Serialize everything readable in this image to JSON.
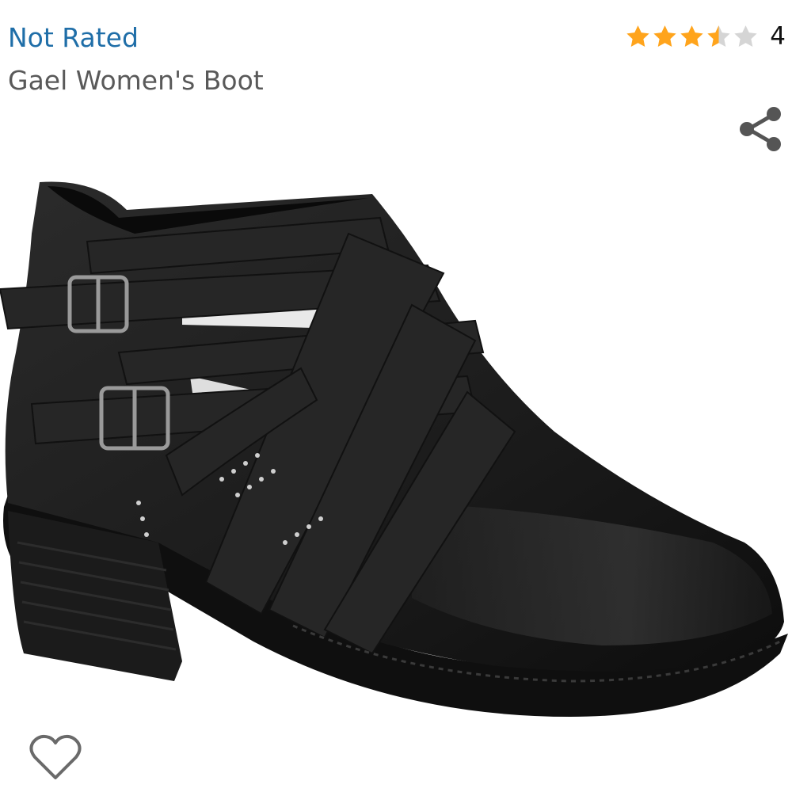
{
  "listing": {
    "brand": "Not Rated",
    "product_title": "Gael Women's Boot"
  },
  "rating": {
    "stars_out_of_5": 3.5,
    "review_count": "4"
  },
  "icons": {
    "share": "share-icon",
    "wishlist": "heart-outline-icon",
    "star": "star-icon"
  },
  "colors": {
    "brand_link": "#1f6ea8",
    "title_text": "#595959",
    "star_filled": "#ffa41c",
    "star_empty": "#d5d5d5",
    "icon_gray": "#555555"
  }
}
